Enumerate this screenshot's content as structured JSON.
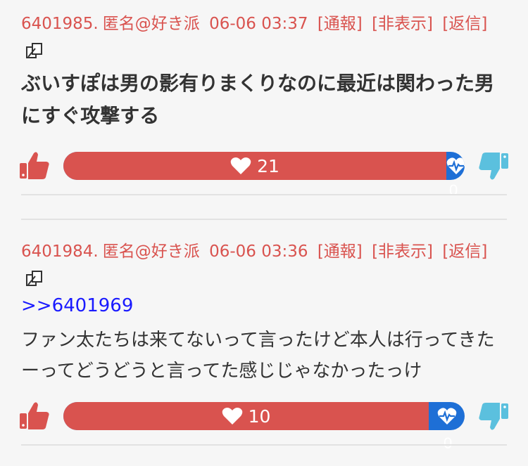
{
  "posts": [
    {
      "number": "6401985.",
      "author": "匿名@好き派",
      "datetime": "06-06 03:37",
      "report_label": "[通報]",
      "hide_label": "[非表示]",
      "reply_label": "[返信]",
      "anchor": "",
      "body": "ぶいすぽは男の影有りまくりなのに最近は関わった男にすぐ攻撃する",
      "good_count": "21",
      "bad_count": "0",
      "good_ratio": 0.955
    },
    {
      "number": "6401984.",
      "author": "匿名@好き派",
      "datetime": "06-06 03:36",
      "report_label": "[通報]",
      "hide_label": "[非表示]",
      "reply_label": "[返信]",
      "anchor": ">>6401969",
      "body": "ファン太たちは来てないって言ったけど本人は行ってきたーってどうどうと言ってた感じじゃなかったっけ",
      "good_count": "10",
      "bad_count": "0",
      "good_ratio": 0.91
    }
  ],
  "icons": {
    "copy": "copy-icon",
    "thumbs_up": "thumbs-up-icon",
    "thumbs_down": "thumbs-down-icon",
    "heart": "heart-icon",
    "heartbeat": "heartbeat-icon"
  },
  "colors": {
    "accent_red": "#d9534f",
    "accent_blue": "#1e6fd6",
    "thumbs_down_blue": "#5bc0de",
    "anchor_blue": "#1a1aff",
    "text": "#333333"
  }
}
